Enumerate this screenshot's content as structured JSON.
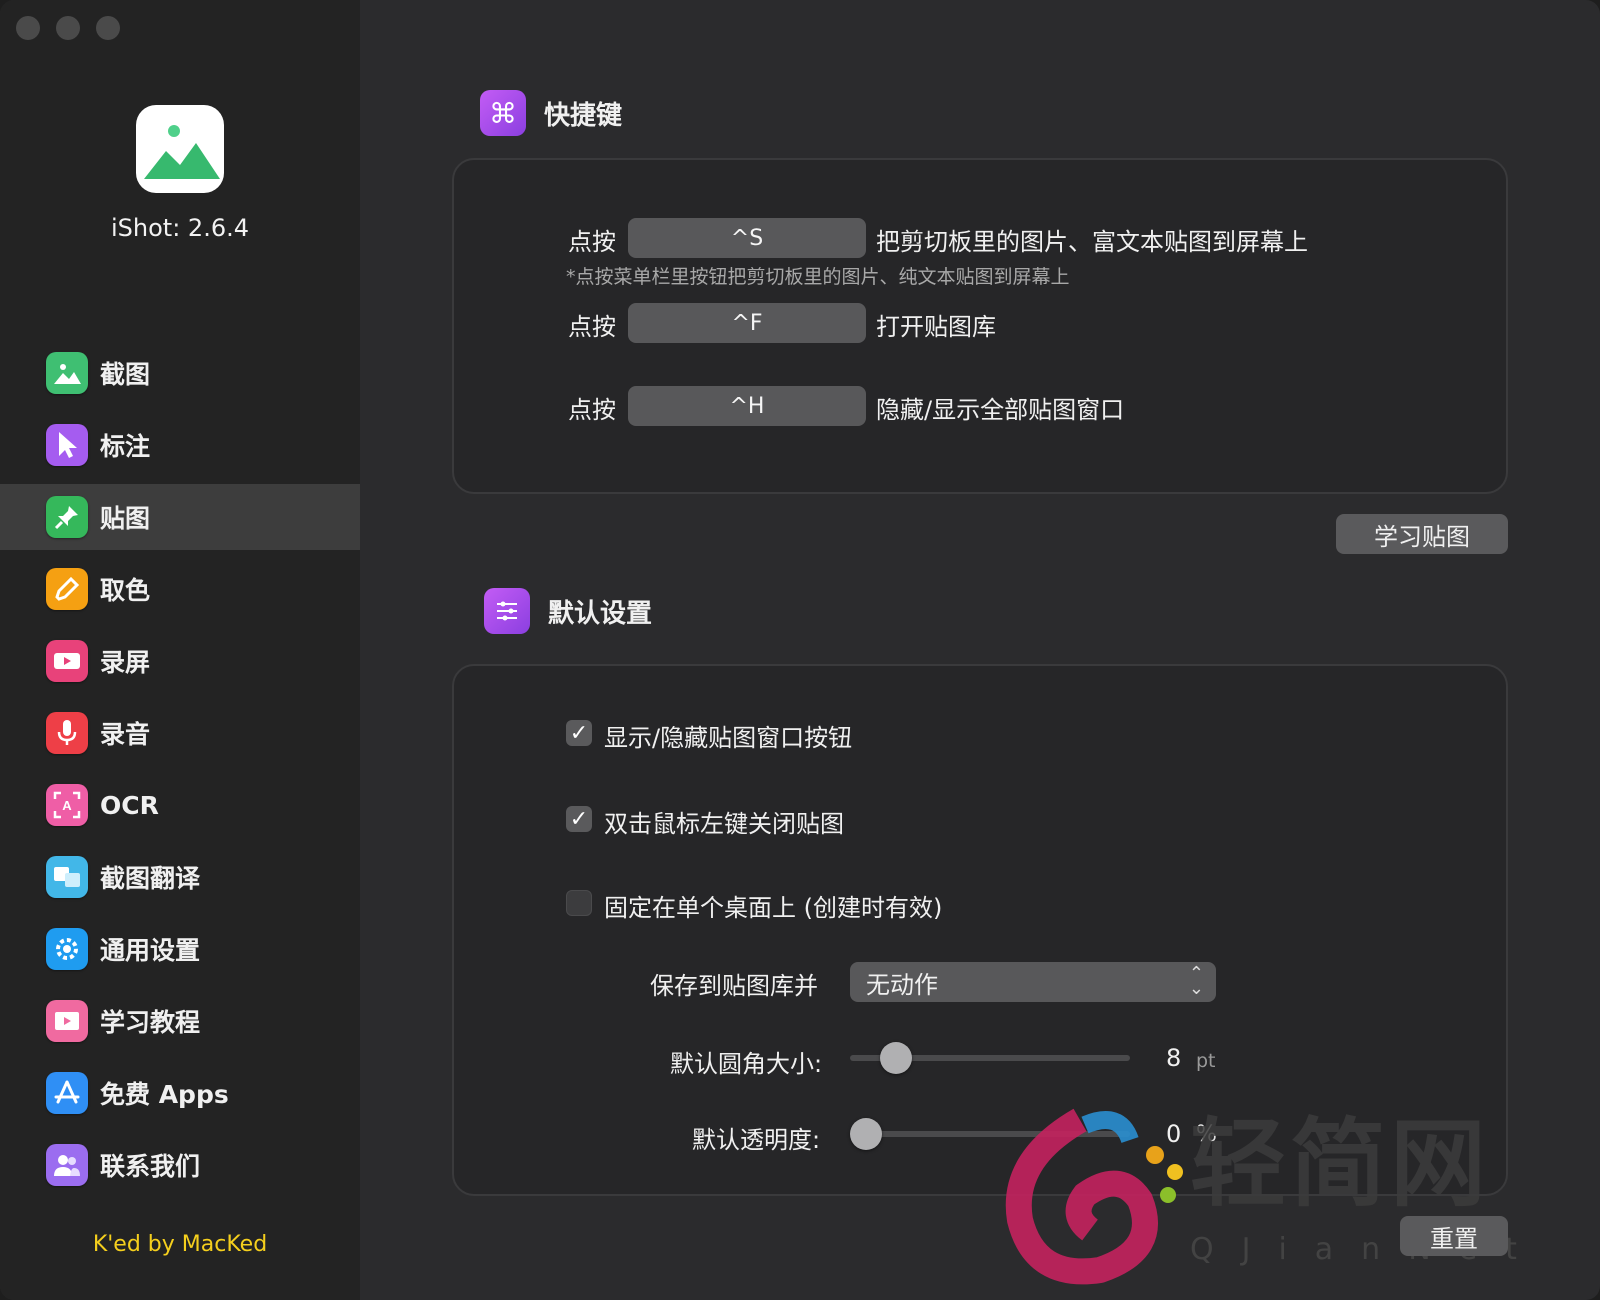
{
  "sidebar": {
    "app_version": "iShot: 2.6.4",
    "items": [
      {
        "label": "截图",
        "icon": "landscape-icon",
        "color": "#3fbf72"
      },
      {
        "label": "标注",
        "icon": "cursor-icon",
        "color": "#a55cf0"
      },
      {
        "label": "贴图",
        "icon": "pin-icon",
        "color": "#35b85b",
        "active": true
      },
      {
        "label": "取色",
        "icon": "eyedropper-icon",
        "color": "#f5a012"
      },
      {
        "label": "录屏",
        "icon": "video-icon",
        "color": "#e8427a"
      },
      {
        "label": "录音",
        "icon": "microphone-icon",
        "color": "#ee3f47"
      },
      {
        "label": "OCR",
        "icon": "ocr-icon",
        "color": "#ef5ea6"
      },
      {
        "label": "截图翻译",
        "icon": "translate-icon",
        "color": "#42b7e8"
      },
      {
        "label": "通用设置",
        "icon": "gear-icon",
        "color": "#1f9cf0"
      },
      {
        "label": "学习教程",
        "icon": "tutorial-icon",
        "color": "#f06aa0"
      },
      {
        "label": "免费 Apps",
        "icon": "app-store-icon",
        "color": "#2f8ff5"
      },
      {
        "label": "联系我们",
        "icon": "people-icon",
        "color": "#9b6df0"
      }
    ],
    "credit": "K'ed by MacKed"
  },
  "shortcuts": {
    "title": "快捷键",
    "rows": [
      {
        "prefix": "点按",
        "key": "^S",
        "desc": "把剪切板里的图片、富文本贴图到屏幕上"
      },
      {
        "prefix": "点按",
        "key": "^F",
        "desc": "打开贴图库"
      },
      {
        "prefix": "点按",
        "key": "^H",
        "desc": "隐藏/显示全部贴图窗口"
      }
    ],
    "hint": "*点按菜单栏里按钮把剪切板里的图片、纯文本贴图到屏幕上",
    "learn_button": "学习贴图"
  },
  "defaults": {
    "title": "默认设置",
    "checkboxes": [
      {
        "label": "显示/隐藏贴图窗口按钮",
        "checked": true
      },
      {
        "label": "双击鼠标左键关闭贴图",
        "checked": true
      },
      {
        "label": "固定在单个桌面上 (创建时有效)",
        "checked": false
      }
    ],
    "save_label": "保存到贴图库并",
    "save_value": "无动作",
    "corner_label": "默认圆角大小:",
    "corner_value": "8",
    "corner_unit": "pt",
    "corner_fraction": 0.12,
    "opacity_label": "默认透明度:",
    "opacity_value": "0",
    "opacity_unit": "%",
    "opacity_fraction": 0.0,
    "reset_button": "重置"
  },
  "watermark": {
    "text": "轻简网",
    "sub": "QJianNet"
  }
}
